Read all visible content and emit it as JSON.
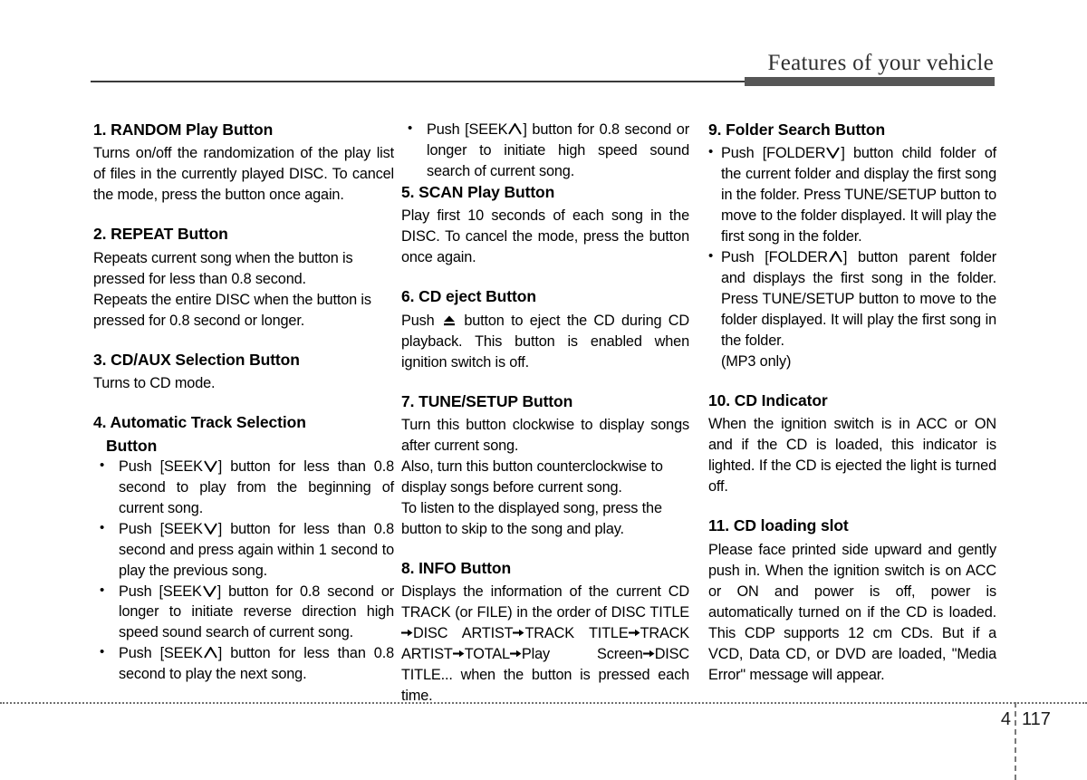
{
  "header": {
    "title": "Features of your vehicle"
  },
  "footer": {
    "chapter": "4",
    "page": "117"
  },
  "columns": {
    "col1": {
      "sections": [
        {
          "title": "1. RANDOM Play Button",
          "paragraphs": [
            "Turns on/off the randomization of the play list of files in the currently played DISC. To cancel the mode, press the button once again."
          ]
        },
        {
          "title": "2. REPEAT Button",
          "paragraphs": [
            "Repeats current song when the button is pressed for less than 0.8 second.",
            "Repeats the entire DISC when the button is pressed for 0.8 second or longer."
          ]
        },
        {
          "title": "3. CD/AUX Selection Button",
          "paragraphs": [
            "Turns to CD mode."
          ]
        },
        {
          "title": "4. Automatic Track Selection",
          "title_cont": "Button",
          "bullets": [
            {
              "pre": "Push [SEEK",
              "icon": "chevron-down-icon",
              "post": "] button for less than 0.8 second to play from the beginning of current song."
            },
            {
              "pre": "Push [SEEK",
              "icon": "chevron-down-icon",
              "post": "] button for less than 0.8 second and press again within 1 second to play the previous song."
            },
            {
              "pre": "Push [SEEK",
              "icon": "chevron-down-icon",
              "post": "] button for 0.8 second or longer to initiate reverse direction high speed sound search of current song."
            },
            {
              "pre": "Push [SEEK",
              "icon": "chevron-up-icon",
              "post": "] button for less than 0.8 second to play the next song."
            }
          ]
        }
      ]
    },
    "col2": {
      "lead_bullets": [
        {
          "pre": "Push [SEEK",
          "icon": "chevron-up-icon",
          "post": "] button for 0.8 second or longer to initiate high speed sound search of current song."
        }
      ],
      "sections": [
        {
          "title": "5. SCAN Play Button",
          "paragraphs": [
            "Play first 10 seconds of each song in the DISC. To cancel the mode, press the button once again."
          ]
        },
        {
          "title": "6. CD eject Button",
          "eject_line": {
            "pre": "Push",
            "icon": "eject-icon",
            "post": "button to eject the CD during CD playback. This button is enabled when ignition switch is off."
          }
        },
        {
          "title": "7. TUNE/SETUP Button",
          "paragraphs": [
            "Turn this button clockwise to display songs after current song.",
            "Also, turn this button counterclockwise to display songs before current song.",
            "To listen to the displayed song, press the button to skip to the song and play."
          ]
        },
        {
          "title": "8. INFO Button",
          "info_line": {
            "p1": "Displays the information of the current CD TRACK (or FILE) in the order of DISC TITLE",
            "p2": "DISC  ARTIST",
            "p3": "TRACK  TITLE",
            "p4": "TRACK  ARTIST",
            "p5": "TOTAL",
            "p6": "Play  Screen",
            "p7": "DISC TITLE... when the button is pressed each time."
          }
        }
      ]
    },
    "col3": {
      "sections": [
        {
          "title": "9. Folder Search Button",
          "bullets": [
            {
              "pre": "Push [FOLDER",
              "icon": "chevron-down-icon",
              "post": "] button child folder of the current folder and display the first song in the folder. Press TUNE/SETUP button to move to the folder displayed. It will play the first song in the folder."
            },
            {
              "pre": "Push [FOLDER",
              "icon": "chevron-up-icon",
              "post": "] button parent folder and displays the first song in the folder. Press TUNE/SETUP button to move to the folder displayed. It will play the first song in the folder."
            }
          ],
          "note": "(MP3 only)"
        },
        {
          "title": "10. CD Indicator",
          "paragraphs": [
            "When the ignition switch is in ACC or ON and if the CD is loaded, this indicator is lighted. If the CD is ejected the light is turned off."
          ]
        },
        {
          "title": "11. CD loading slot",
          "paragraphs": [
            "Please face printed side upward and gently push in. When the ignition switch is on ACC or ON and power is off, power is automatically turned on if the CD is loaded. This CDP supports 12 cm CDs. But if a VCD, Data CD, or DVD are loaded, \"Media Error\" message will appear."
          ]
        }
      ]
    }
  }
}
